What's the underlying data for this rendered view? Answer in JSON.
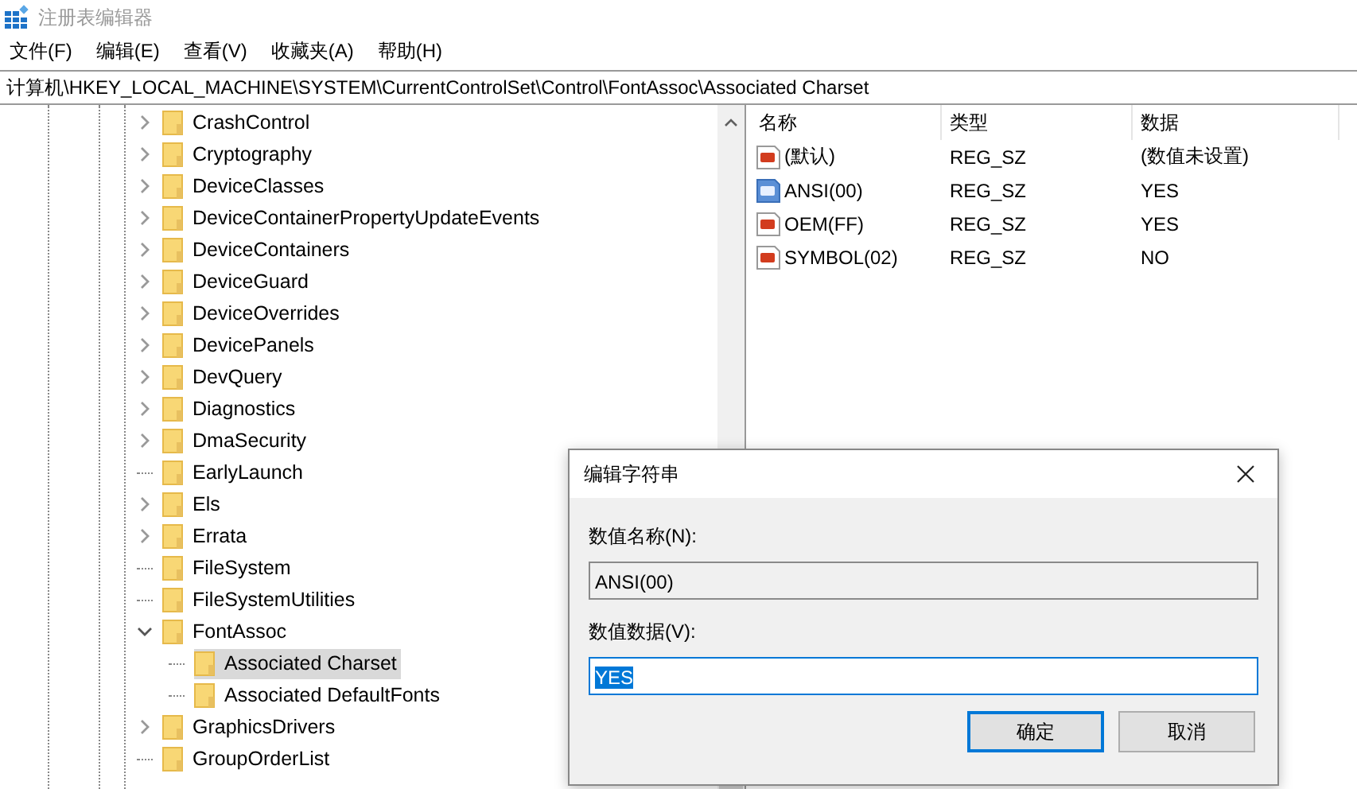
{
  "window": {
    "title": "注册表编辑器"
  },
  "menu": [
    "文件(F)",
    "编辑(E)",
    "查看(V)",
    "收藏夹(A)",
    "帮助(H)"
  ],
  "address": "计算机\\HKEY_LOCAL_MACHINE\\SYSTEM\\CurrentControlSet\\Control\\FontAssoc\\Associated Charset",
  "tree": [
    {
      "label": "CrashControl",
      "kind": "branch",
      "expanded": false,
      "selected": false
    },
    {
      "label": "Cryptography",
      "kind": "branch",
      "expanded": false,
      "selected": false
    },
    {
      "label": "DeviceClasses",
      "kind": "branch",
      "expanded": false,
      "selected": false
    },
    {
      "label": "DeviceContainerPropertyUpdateEvents",
      "kind": "branch",
      "expanded": false,
      "selected": false
    },
    {
      "label": "DeviceContainers",
      "kind": "branch",
      "expanded": false,
      "selected": false
    },
    {
      "label": "DeviceGuard",
      "kind": "branch",
      "expanded": false,
      "selected": false
    },
    {
      "label": "DeviceOverrides",
      "kind": "branch",
      "expanded": false,
      "selected": false
    },
    {
      "label": "DevicePanels",
      "kind": "branch",
      "expanded": false,
      "selected": false
    },
    {
      "label": "DevQuery",
      "kind": "branch",
      "expanded": false,
      "selected": false
    },
    {
      "label": "Diagnostics",
      "kind": "branch",
      "expanded": false,
      "selected": false
    },
    {
      "label": "DmaSecurity",
      "kind": "branch",
      "expanded": false,
      "selected": false
    },
    {
      "label": "EarlyLaunch",
      "kind": "leaf",
      "selected": false
    },
    {
      "label": "Els",
      "kind": "branch",
      "expanded": false,
      "selected": false
    },
    {
      "label": "Errata",
      "kind": "branch",
      "expanded": false,
      "selected": false
    },
    {
      "label": "FileSystem",
      "kind": "leaf",
      "selected": false
    },
    {
      "label": "FileSystemUtilities",
      "kind": "leaf",
      "selected": false
    },
    {
      "label": "FontAssoc",
      "kind": "branch",
      "expanded": true,
      "selected": false,
      "children": [
        {
          "label": "Associated Charset",
          "kind": "leaf",
          "selected": true
        },
        {
          "label": "Associated DefaultFonts",
          "kind": "leaf",
          "selected": false
        }
      ]
    },
    {
      "label": "GraphicsDrivers",
      "kind": "branch",
      "expanded": false,
      "selected": false
    },
    {
      "label": "GroupOrderList",
      "kind": "leaf",
      "selected": false
    }
  ],
  "values": {
    "columns": [
      "名称",
      "类型",
      "数据"
    ],
    "rows": [
      {
        "name": "(默认)",
        "type": "REG_SZ",
        "data": "(数值未设置)",
        "selected": false
      },
      {
        "name": "ANSI(00)",
        "type": "REG_SZ",
        "data": "YES",
        "selected": true
      },
      {
        "name": "OEM(FF)",
        "type": "REG_SZ",
        "data": "YES",
        "selected": false
      },
      {
        "name": "SYMBOL(02)",
        "type": "REG_SZ",
        "data": "NO",
        "selected": false
      }
    ]
  },
  "dialog": {
    "title": "编辑字符串",
    "name_label": "数值名称(N):",
    "name_value": "ANSI(00)",
    "data_label": "数值数据(V):",
    "data_value": "YES",
    "data_value_selected": true,
    "buttons": [
      {
        "label": "确定",
        "default": true
      },
      {
        "label": "取消",
        "default": false
      }
    ]
  }
}
